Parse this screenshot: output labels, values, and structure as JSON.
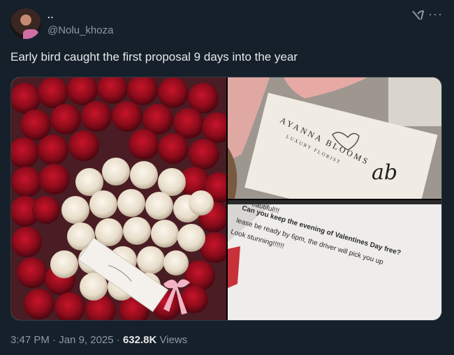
{
  "author": {
    "display_name": "..",
    "handle": "@Nolu_khoza",
    "avatar_icon": "profile-avatar"
  },
  "tweet": {
    "text": "Early bird caught the first proposal 9 days into the year"
  },
  "card_image": {
    "brand_line1": "AYANNA BLOOMS",
    "brand_line2": "LUXURY FLORIST",
    "monogram": "ab"
  },
  "note_image": {
    "lines": [
      "eautiful!!!",
      "Can you keep the evening of Valentines Day free?",
      "lease be ready by 6pm, the driver will pick you up",
      "Look stunning!!!!!!"
    ]
  },
  "footer": {
    "time": "3:47 PM",
    "separator1": "·",
    "date": "Jan 9, 2025",
    "separator2": "·",
    "views_count": "632.8K",
    "views_label": "Views"
  },
  "icons": {
    "grok": "grok-icon",
    "more": "more-options-icon"
  },
  "colors": {
    "background": "#15202b",
    "text_primary": "#e7e9ea",
    "text_secondary": "#8b98a5"
  }
}
